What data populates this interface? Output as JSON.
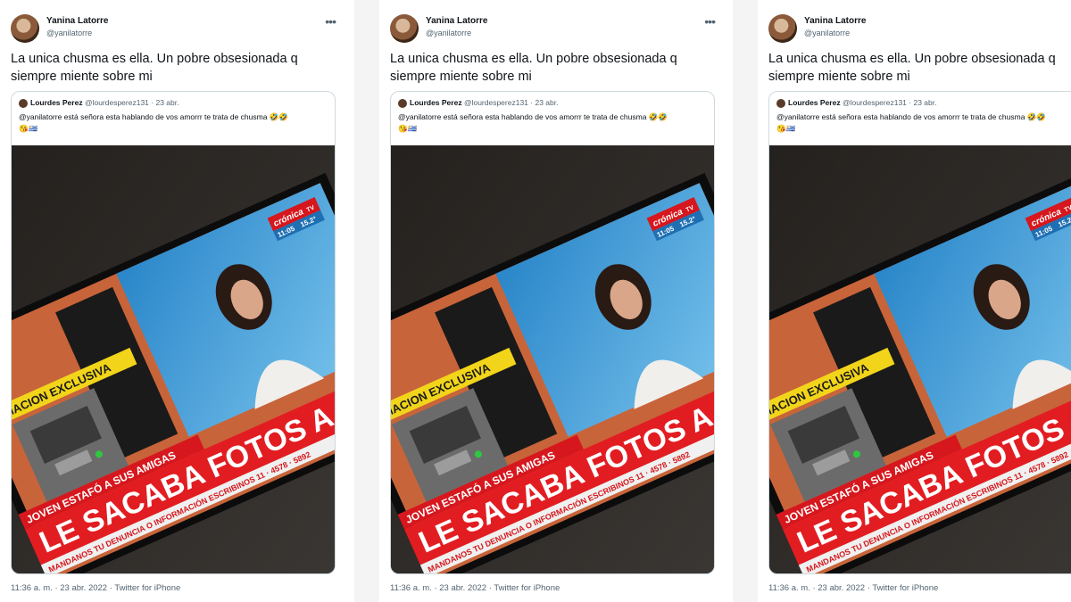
{
  "tweet": {
    "author_name": "Yanina Latorre",
    "author_handle": "@yanilatorre",
    "more_icon": "ellipsis-icon",
    "text_line1": "La unica chusma es ella. Un pobre obsesionada q",
    "text_line2": "siempre miente sobre mi",
    "timestamp": "11:36 a. m. · 23 abr. 2022 · Twitter for iPhone"
  },
  "quote": {
    "author_name": "Lourdes Perez",
    "author_handle": "@lourdesperez131",
    "date": "· 23 abr.",
    "text": "@yanilatorre está señora esta hablando de vos amorrr te trata de chusma 🤣🤣",
    "text_line2": "😘🇺🇾"
  },
  "tv": {
    "channel_logo": "crónica",
    "channel_tv": "TV",
    "clock_time": "11:05",
    "clock_temp": "15.2°",
    "banner_top": "FORMACION EXCLUSIVA",
    "headline_small": "JOVEN ESTAFÓ A SUS AMIGAS",
    "headline_big": "LE SACABA FOTOS A SUS TAR",
    "ticker": "MANDANOS TU DENUNCIA O INFORMACIÓN    ESCRIBINOS 11 · 4578 · 5892",
    "atm_label": "CAJERO"
  },
  "colors": {
    "text": "#0f1419",
    "secondary": "#536471",
    "border": "#cfd9de",
    "tv_red": "#d6171d",
    "tv_yellow": "#f2d51a",
    "studio_blue": "#3d9fd8"
  }
}
